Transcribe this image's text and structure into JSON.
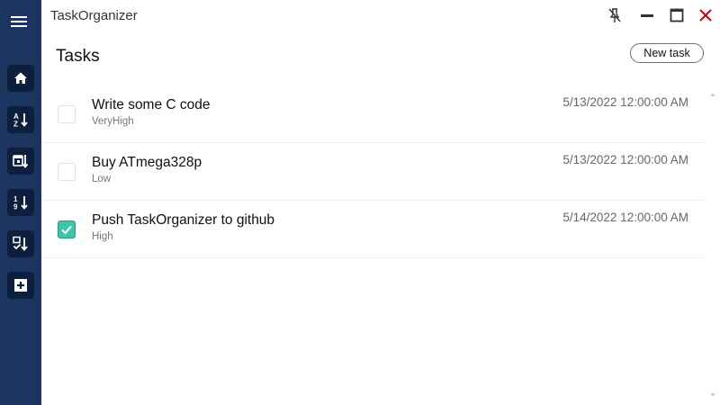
{
  "window": {
    "title": "TaskOrganizer",
    "controls": [
      {
        "icon": "unpin-icon"
      },
      {
        "icon": "minimize-icon"
      },
      {
        "icon": "maximize-icon"
      },
      {
        "icon": "close-icon",
        "color": "#d0021b"
      }
    ]
  },
  "sidebar": {
    "background": "#1c3560",
    "button_background": "#0c1f3d",
    "items": [
      {
        "icon": "home-icon"
      },
      {
        "icon": "sort-alphabetical-icon"
      },
      {
        "icon": "sort-by-date-icon"
      },
      {
        "icon": "sort-by-priority-icon"
      },
      {
        "icon": "sort-by-completed-icon"
      },
      {
        "icon": "add-task-icon"
      }
    ]
  },
  "page": {
    "title": "Tasks",
    "new_task_label": "New task"
  },
  "tasks": [
    {
      "name": "Write some C code",
      "priority": "VeryHigh",
      "date": "5/13/2022 12:00:00 AM",
      "done": false
    },
    {
      "name": "Buy ATmega328p",
      "priority": "Low",
      "date": "5/13/2022 12:00:00 AM",
      "done": false
    },
    {
      "name": "Push TaskOrganizer to github",
      "priority": "High",
      "date": "5/14/2022 12:00:00 AM",
      "done": true
    }
  ],
  "colors": {
    "accent_check": "#3fc4a8",
    "close": "#d0021b"
  }
}
